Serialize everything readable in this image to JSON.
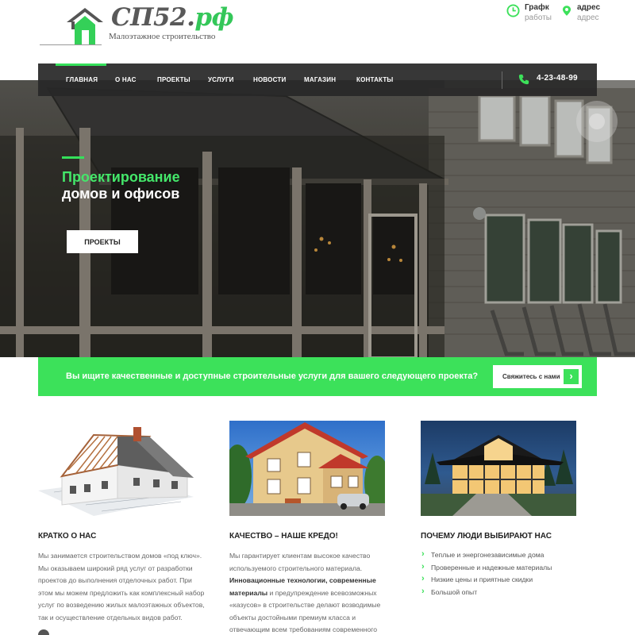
{
  "logo": {
    "title_main": "СП52.",
    "title_tld": "рф",
    "subtitle": "Малоэтажное строительство"
  },
  "header_info": {
    "hours_title": "Графк",
    "hours_sub": "работы",
    "address_title": "адрес",
    "address_sub": "адрес"
  },
  "nav": {
    "items": [
      "ГЛАВНАЯ",
      "О НАС",
      "ПРОЕКТЫ",
      "УСЛУГИ",
      "НОВОСТИ",
      "МАГАЗИН",
      "КОНТАКТЫ"
    ],
    "phone": "4-23-48-99"
  },
  "hero": {
    "title_line1": "Проектирование",
    "title_line2": "домов и офисов",
    "button": "ПРОЕКТЫ"
  },
  "cta": {
    "text": "Вы ищите качественные и доступные строительные услуги для вашего следующего проекта?",
    "button": "Свяжитесь с нами",
    "arrow": "›"
  },
  "columns": {
    "about": {
      "title": "КРАТКО О НАС",
      "text": "Мы занимается строительством домов «под ключ». Мы оказываем широкий ряд услуг от разработки проектов до выполнения отделочных работ. При этом мы можем предложить как комплексный набор услуг по возведению жилых малоэтажных объектов, так и осуществление отдельных видов работ."
    },
    "quality": {
      "title": "КАЧЕСТВО – НАШЕ КРЕДО!",
      "text_before": "Мы гарантирует клиентам высокое качество используемого строительного материала.",
      "text_bold": "Инновационные технологии, современные материалы",
      "text_after": "и предупреждение всевозможных «казусов» в строительстве делают возводимые объекты достойными премиум класса и отвечающим всем требованиям современного общества."
    },
    "why": {
      "title": "ПОЧЕМУ ЛЮДИ ВЫБИРАЮТ НАС",
      "items": [
        "Теплые и энергонезависимые дома",
        "Проверенные и надежные материалы",
        "Низкие цены и приятные скидки",
        "Большой опыт"
      ]
    }
  },
  "colors": {
    "accent_green": "#3ce15a",
    "nav_bg": "#282828",
    "text_grey": "#666666"
  },
  "icons": {
    "hours": "clock-icon",
    "address": "map-pin-icon",
    "phone": "phone-icon",
    "logo": "house-icon"
  }
}
